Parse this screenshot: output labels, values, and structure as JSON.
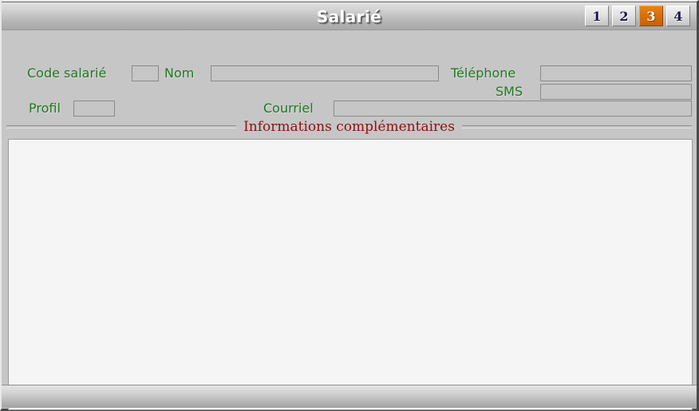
{
  "window": {
    "title": "Salarié"
  },
  "tabs": [
    {
      "label": "1",
      "active": false
    },
    {
      "label": "2",
      "active": false
    },
    {
      "label": "3",
      "active": true
    },
    {
      "label": "4",
      "active": false
    }
  ],
  "form": {
    "code_salarie": {
      "label": "Code salarié",
      "value": "",
      "placeholder": ""
    },
    "nom": {
      "label": "Nom",
      "value": "",
      "placeholder": ""
    },
    "telephone": {
      "label": "Téléphone",
      "value": "",
      "placeholder": ""
    },
    "sms": {
      "label": "SMS",
      "value": "",
      "placeholder": ""
    },
    "profil": {
      "label": "Profil",
      "value": "",
      "placeholder": ""
    },
    "courriel": {
      "label": "Courriel",
      "value": "",
      "placeholder": ""
    }
  },
  "section": {
    "title": "Informations complémentaires",
    "notes": {
      "value": "",
      "placeholder": ""
    }
  },
  "status": {
    "text": ""
  },
  "colors": {
    "label_green": "#1e7a1e",
    "section_red": "#8f1010",
    "active_tab_orange": "#d96f08",
    "window_face": "#c6c6c6",
    "notes_background": "#f5f5f5"
  }
}
